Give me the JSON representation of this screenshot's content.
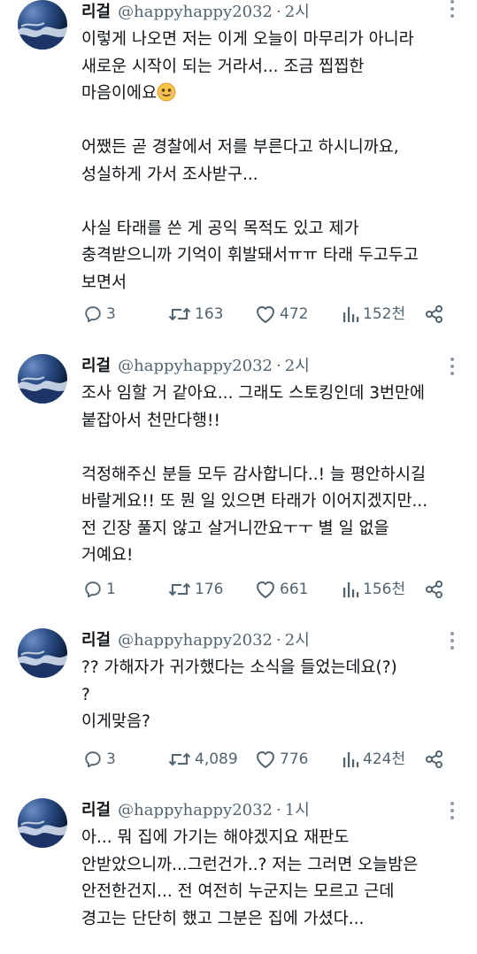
{
  "colors": {
    "text": "#0f1419",
    "secondary": "#536471",
    "background": "#ffffff"
  },
  "tweets": [
    {
      "name": "리걸",
      "handle": "@happyhappy2032",
      "separator": "·",
      "time": "2시",
      "lines": [
        "이렇게 나오면 저는 이게 오늘이 마무리가 아니라",
        "새로운 시작이 되는 거라서... 조금 찝찝한",
        "마음이에요",
        "",
        "어쨌든 곧 경찰에서 저를 부른다고 하시니까요,",
        "성실하게 가서 조사받구...",
        "",
        "사실 타래를 쓴 게 공익 목적도 있고 제가",
        "충격받으니까 기억이 휘발돼서ㅠㅠ 타래 두고두고",
        "보면서"
      ],
      "emoji": "slightly-smiling-face-icon",
      "replies": "3",
      "retweets": "163",
      "likes": "472",
      "views": "152천"
    },
    {
      "name": "리걸",
      "handle": "@happyhappy2032",
      "separator": "·",
      "time": "2시",
      "lines": [
        "조사 임할 거 같아요... 그래도 스토킹인데 3번만에",
        "붙잡아서 천만다행!!",
        "",
        "걱정해주신 분들 모두 감사합니다..! 늘 평안하시길",
        "바랄게요!! 또 뭔 일 있으면 타래가 이어지겠지만...",
        "전 긴장 풀지 않고 살거니깐요ㅜㅜ 별 일 없을",
        "거예요!"
      ],
      "replies": "1",
      "retweets": "176",
      "likes": "661",
      "views": "156천"
    },
    {
      "name": "리걸",
      "handle": "@happyhappy2032",
      "separator": "·",
      "time": "2시",
      "lines": [
        "?? 가해자가 귀가했다는 소식을 들었는데요(?)",
        "?",
        "이게맞음?"
      ],
      "replies": "3",
      "retweets": "4,089",
      "likes": "776",
      "views": "424천"
    },
    {
      "name": "리걸",
      "handle": "@happyhappy2032",
      "separator": "·",
      "time": "1시",
      "lines": [
        "아... 뭐 집에 가기는 해야겠지요 재판도",
        "안받았으니까...그런건가..? 저는 그러면 오늘밤은",
        "안전한건지... 전 여전히 누군지는 모르고 근데",
        "경고는 단단히 했고 그분은 집에 가셨다..."
      ]
    }
  ]
}
